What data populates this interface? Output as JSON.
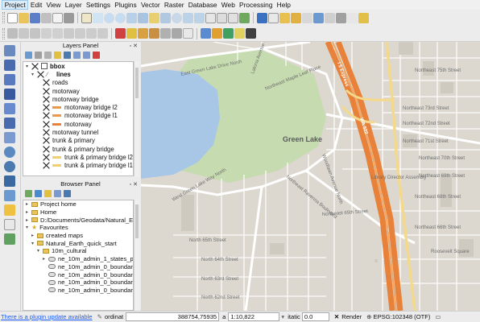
{
  "menu": [
    "Project",
    "Edit",
    "View",
    "Layer",
    "Settings",
    "Plugins",
    "Vector",
    "Raster",
    "Database",
    "Web",
    "Processing",
    "Help"
  ],
  "layers_panel": {
    "title": "Layers Panel",
    "group": "bbox",
    "subgroup": "lines",
    "items": [
      {
        "label": "roads",
        "color": ""
      },
      {
        "label": "motorway",
        "color": ""
      },
      {
        "label": "motorway bridge",
        "color": ""
      },
      {
        "label": "motorway bridge l2",
        "color": "#e89a4a"
      },
      {
        "label": "motorway bridge l1",
        "color": "#e89a4a"
      },
      {
        "label": "motorway",
        "color": "#e8823a"
      },
      {
        "label": "motorway tunnel",
        "color": ""
      },
      {
        "label": "trunk & primary",
        "color": ""
      },
      {
        "label": "trunk & primary bridge",
        "color": ""
      },
      {
        "label": "trunk & primary bridge l2",
        "color": "#f0d070"
      },
      {
        "label": "trunk & primary bridge l1",
        "color": "#f0d070"
      }
    ]
  },
  "browser_panel": {
    "title": "Browser Panel",
    "items": [
      {
        "label": "Project home",
        "indent": 0,
        "kind": "folder",
        "arrow": "▸"
      },
      {
        "label": "Home",
        "indent": 0,
        "kind": "folder",
        "arrow": "▸"
      },
      {
        "label": "D:/Documents/Geodata/Natural_Ear",
        "indent": 0,
        "kind": "folder",
        "arrow": "▸"
      },
      {
        "label": "Favourites",
        "indent": 0,
        "kind": "star",
        "arrow": "▾"
      },
      {
        "label": "created maps",
        "indent": 1,
        "kind": "folder",
        "arrow": "▸"
      },
      {
        "label": "Natural_Earth_quick_start",
        "indent": 1,
        "kind": "folder",
        "arrow": "▾"
      },
      {
        "label": "10m_cultural",
        "indent": 2,
        "kind": "folder",
        "arrow": "▾"
      },
      {
        "label": "ne_10m_admin_1_states_pro",
        "indent": 3,
        "kind": "layer",
        "arrow": "▸"
      },
      {
        "label": "ne_10m_admin_0_boundar",
        "indent": 3,
        "kind": "layer",
        "arrow": ""
      },
      {
        "label": "ne_10m_admin_0_boundar",
        "indent": 3,
        "kind": "layer",
        "arrow": ""
      },
      {
        "label": "ne_10m_admin_0_boundar",
        "indent": 3,
        "kind": "layer",
        "arrow": ""
      },
      {
        "label": "ne_10m_admin_0_boundar",
        "indent": 3,
        "kind": "layer",
        "arrow": ""
      }
    ]
  },
  "map": {
    "place_label": "Green Lake",
    "street_labels": {
      "ne75": "Northeast 75th Street",
      "ne73": "Northeast 73rd Street",
      "ne72": "Northeast 72nd Street",
      "ne71": "Northeast 71st Street",
      "ne70": "Northeast 70th Street",
      "ne69": "Northeast 69th Street",
      "ne68": "Northeast 68th Street",
      "ne66": "Northeast 66th Street",
      "ne65": "Northeast 65th Street",
      "n65": "North 65th Street",
      "n64": "North 64th Street",
      "n63": "North 63rd Street",
      "n62": "North 62nd Street",
      "egl": "East Green Lake Drive North",
      "wgl": "West Green Lake Way North",
      "maple": "Northeast Maple Leaf Place",
      "ravenna": "Northeast Ravenna Boulevard",
      "woodlawn": "Woodlawn Avenue North",
      "latona": "Latona Avenue Northeast",
      "i5": "I 5 Express",
      "wa522": "WA 522",
      "library": "Library Director Assembly",
      "park": "Roosevelt Square"
    }
  },
  "status": {
    "update_link": "There is a plugin update available",
    "coord_label": "ordinat",
    "coord_value": "388754,75935",
    "scale_label": "a",
    "scale_value": "1:10,822",
    "rotation_label": "itatic",
    "rotation_value": "0.0",
    "render_label": "Render",
    "crs": "EPSG:102348 (OTF)"
  }
}
